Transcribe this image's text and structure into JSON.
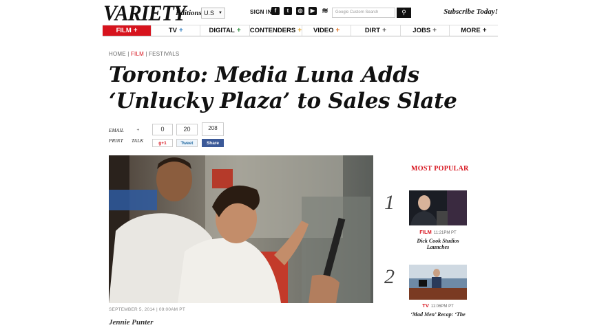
{
  "header": {
    "logo": "VARIETY",
    "editions_label": "Editions:",
    "edition_value": "U.S",
    "signin": "SIGN IN",
    "social_icons": [
      "facebook-icon",
      "twitter-icon",
      "instagram-icon",
      "youtube-icon",
      "rss-icon"
    ],
    "search_placeholder": "Google Custom Search",
    "subscribe": "Subscribe Today!"
  },
  "nav": [
    {
      "label": "FILM",
      "plus_color": "#ffffff"
    },
    {
      "label": "TV",
      "plus_color": "#2b7bbf"
    },
    {
      "label": "DIGITAL",
      "plus_color": "#2e8b3d"
    },
    {
      "label": "CONTENDERS",
      "plus_color": "#e0a020"
    },
    {
      "label": "VIDEO",
      "plus_color": "#e07020"
    },
    {
      "label": "DIRT",
      "plus_color": "#555555"
    },
    {
      "label": "JOBS",
      "plus_color": "#555555"
    },
    {
      "label": "MORE",
      "plus_color": "#111111"
    }
  ],
  "breadcrumb": {
    "home": "HOME",
    "film": "FILM",
    "festivals": "FESTIVALS"
  },
  "article": {
    "headline": "Toronto: Media Luna Adds ‘Unlucky Plaza’ to Sales Slate",
    "dateline": "SEPTEMBER 5, 2014 | 09:00AM PT",
    "author": "Jennie Punter"
  },
  "share": {
    "email": "EMAIL",
    "print": "PRINT",
    "talk": "TALK",
    "plus_sign": "+",
    "gplus_count": "0",
    "twitter_count": "20",
    "facebook_count": "208",
    "gplus_label": "g+1",
    "tweet_label": "Tweet",
    "fb_label": "Share"
  },
  "sidebar": {
    "heading": "MOST POPULAR",
    "items": [
      {
        "rank": "1",
        "category": "FILM",
        "time": "11:21PM PT",
        "title": "Dick Cook Studios Launches"
      },
      {
        "rank": "2",
        "category": "TV",
        "time": "11:06PM PT",
        "title": "‘Mad Men’ Recap: ‘The"
      }
    ]
  },
  "colors": {
    "accent": "#d7131d",
    "text": "#111111"
  }
}
